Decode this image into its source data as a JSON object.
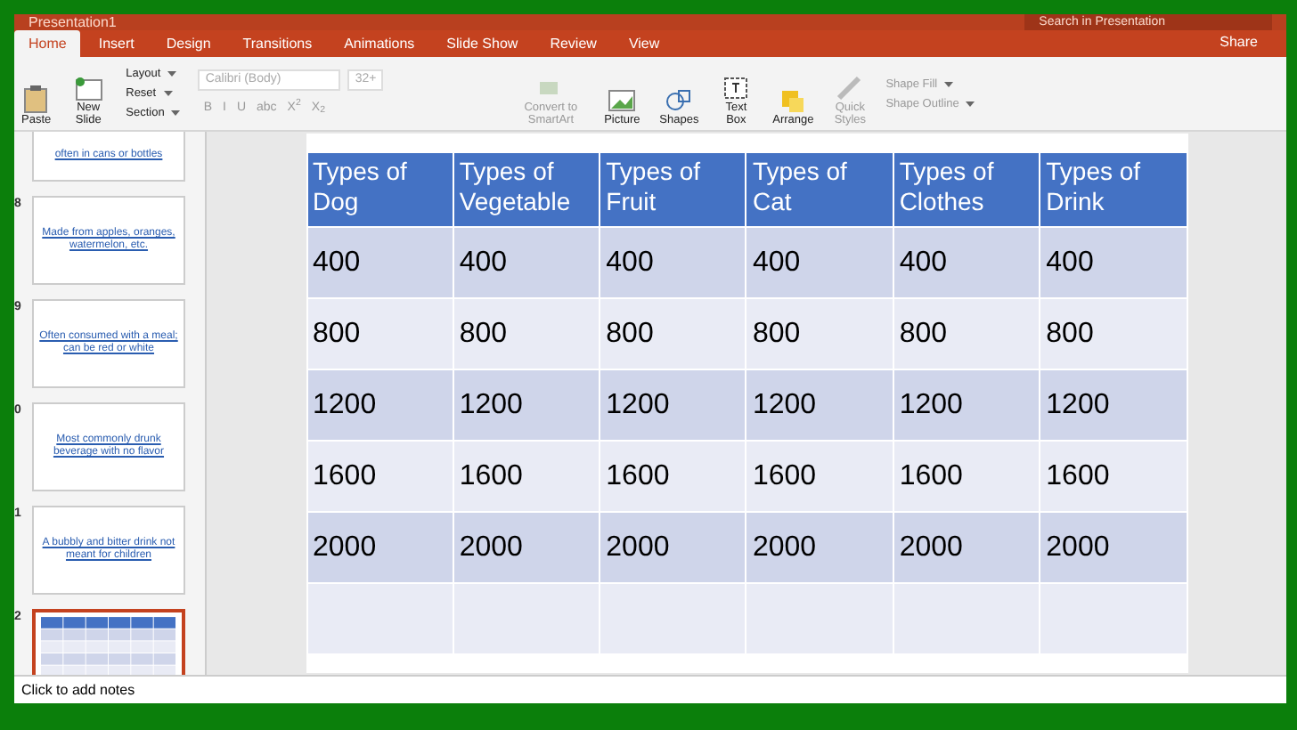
{
  "window": {
    "title": "Presentation1",
    "search_placeholder": "Search in Presentation"
  },
  "tabs": [
    {
      "label": "Home",
      "selected": true
    },
    {
      "label": "Insert",
      "selected": false
    },
    {
      "label": "Design",
      "selected": false
    },
    {
      "label": "Transitions",
      "selected": false
    },
    {
      "label": "Animations",
      "selected": false
    },
    {
      "label": "Slide Show",
      "selected": false
    },
    {
      "label": "Review",
      "selected": false
    },
    {
      "label": "View",
      "selected": false
    }
  ],
  "share": "Share",
  "ribbon": {
    "paste": "Paste",
    "new_slide": "New Slide",
    "slide_menu": [
      {
        "label": "Layout"
      },
      {
        "label": "Reset"
      },
      {
        "label": "Section"
      }
    ],
    "font": {
      "value": "Calibri (Body)",
      "size": "32+",
      "disabled": true,
      "format_buttons": [
        "B",
        "I",
        "U",
        "abc",
        "X$^{2}$",
        "X$_{2}$"
      ]
    },
    "large_buttons": [
      {
        "label": "Convert to SmartArt",
        "disabled": true,
        "kind": "smartart"
      },
      {
        "label": "Picture",
        "disabled": false,
        "kind": "picture"
      },
      {
        "label": "Shapes",
        "disabled": false,
        "kind": "shapes"
      },
      {
        "label": "Text Box",
        "disabled": false,
        "kind": "textbox"
      },
      {
        "label": "Arrange",
        "disabled": false,
        "kind": "arrange"
      },
      {
        "label": "Quick Styles",
        "disabled": true,
        "kind": "styles"
      }
    ],
    "shape_menu": [
      {
        "label": "Shape Fill",
        "disabled": true
      },
      {
        "label": "Shape Outline",
        "disabled": true
      }
    ]
  },
  "slides": [
    {
      "text": "often in cans or bottles",
      "selected": false,
      "kind": "text"
    },
    {
      "number": "8",
      "text": "Made from apples, oranges, watermelon, etc.",
      "selected": false,
      "kind": "text"
    },
    {
      "number": "9",
      "text": "Often consumed with a meal; can be red or white",
      "selected": false,
      "kind": "text"
    },
    {
      "number": "0",
      "text": "Most commonly drunk beverage with no flavor",
      "selected": false,
      "kind": "text"
    },
    {
      "number": "1",
      "text": "A bubbly and bitter drink not meant for children",
      "selected": false,
      "kind": "text"
    },
    {
      "number": "2",
      "selected": true,
      "kind": "table"
    }
  ],
  "table": {
    "columns": [
      "Types of Dog",
      "Types of Vegetable",
      "Types of Fruit",
      "Types of Cat",
      "Types of Clothes",
      "Types of Drink"
    ],
    "rows": [
      [
        "400",
        "400",
        "400",
        "400",
        "400",
        "400"
      ],
      [
        "800",
        "800",
        "800",
        "800",
        "800",
        "800"
      ],
      [
        "1200",
        "1200",
        "1200",
        "1200",
        "1200",
        "1200"
      ],
      [
        "1600",
        "1600",
        "1600",
        "1600",
        "1600",
        "1600"
      ],
      [
        "2000",
        "2000",
        "2000",
        "2000",
        "2000",
        "2000"
      ],
      [
        "",
        "",
        "",
        "",
        "",
        ""
      ]
    ]
  },
  "notes_placeholder": "Click to add notes"
}
